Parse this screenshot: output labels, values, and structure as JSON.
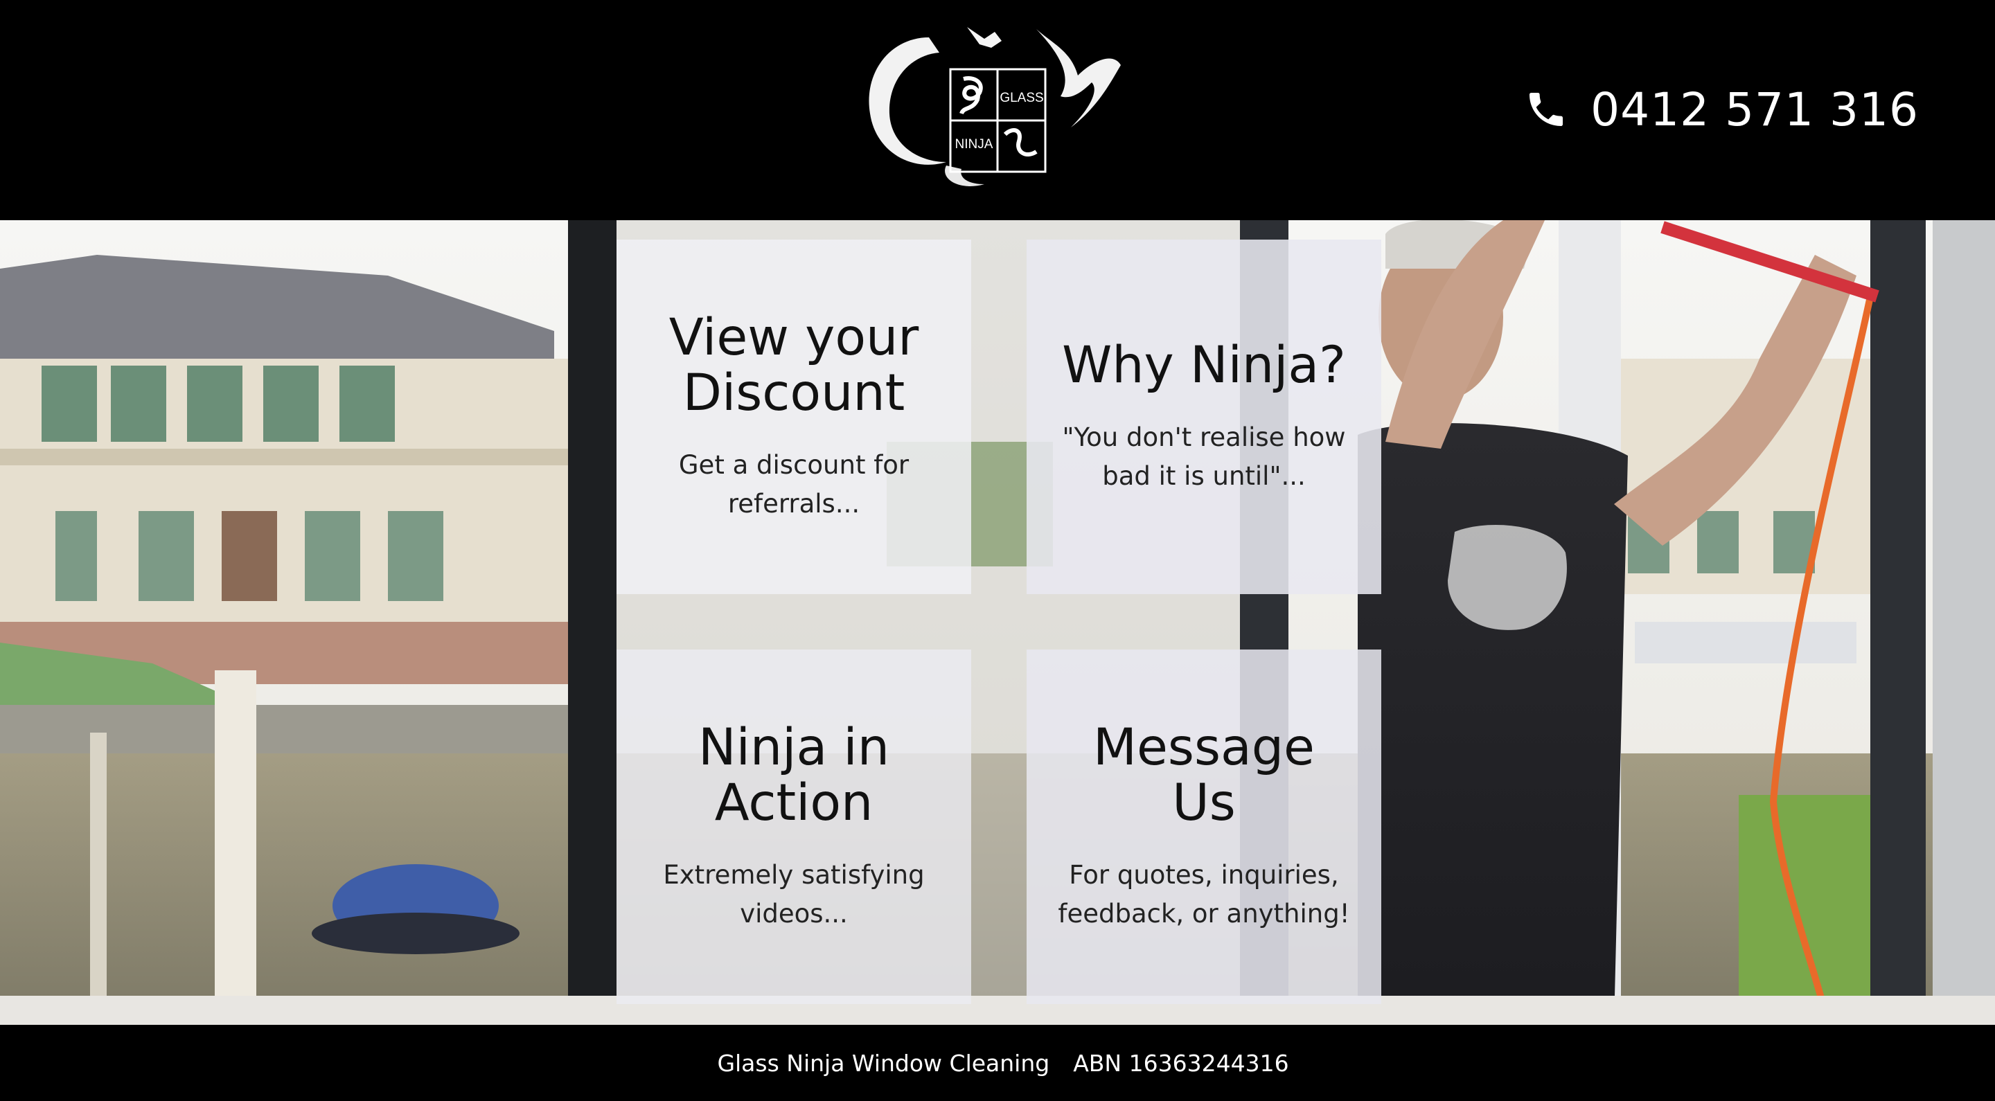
{
  "header": {
    "logo": {
      "alt_text": "GLASS NINJA",
      "word_top": "GLASS",
      "word_bottom": "NINJA"
    },
    "phone": {
      "icon": "phone-icon",
      "number": "0412 571 316"
    }
  },
  "cards": [
    {
      "title": "View your Discount",
      "description": "Get a discount for referrals..."
    },
    {
      "title": "Why Ninja?",
      "description": "\"You don't realise how bad it is until\"..."
    },
    {
      "title": "Ninja in Action",
      "description": "Extremely satisfying videos..."
    },
    {
      "title": "Message Us",
      "description": "For quotes, inquiries, feedback, or anything!"
    }
  ],
  "footer": {
    "company": "Glass Ninja Window Cleaning",
    "abn": "ABN 16363244316"
  },
  "colors": {
    "header_bg": "#000000",
    "card_bg": "#F0F0F4",
    "text_dark": "#111111",
    "text_light": "#FFFFFF"
  }
}
